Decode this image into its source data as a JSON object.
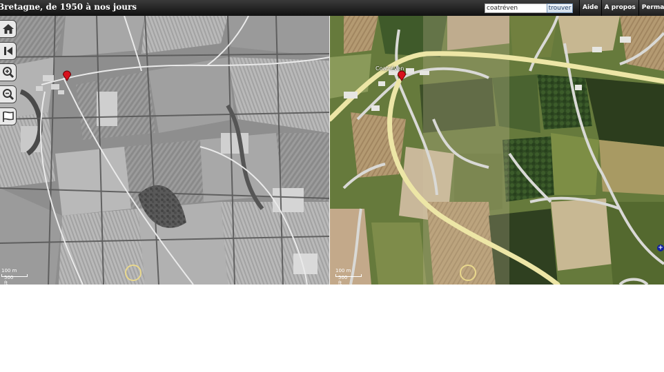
{
  "header": {
    "title": "Bretagne, de 1950 à nos jours",
    "search_value": "coatréven",
    "search_button": "trouver",
    "menu": [
      "Aide",
      "A propos",
      "Permalien"
    ]
  },
  "map_left": {
    "scale_label": "100 m",
    "scale_label_2": "500 ft"
  },
  "map_right": {
    "place_label": "Coatréven",
    "scale_label": "100 m",
    "scale_label_2": "500 ft"
  },
  "nav_tools": [
    "home-icon",
    "back-icon",
    "zoom-in-icon",
    "zoom-out-icon",
    "layers-icon"
  ],
  "colors": {
    "marker": "#d8101c",
    "road": "#ede6a6",
    "locator": "#e9d88c",
    "expand": "#1020a0"
  }
}
